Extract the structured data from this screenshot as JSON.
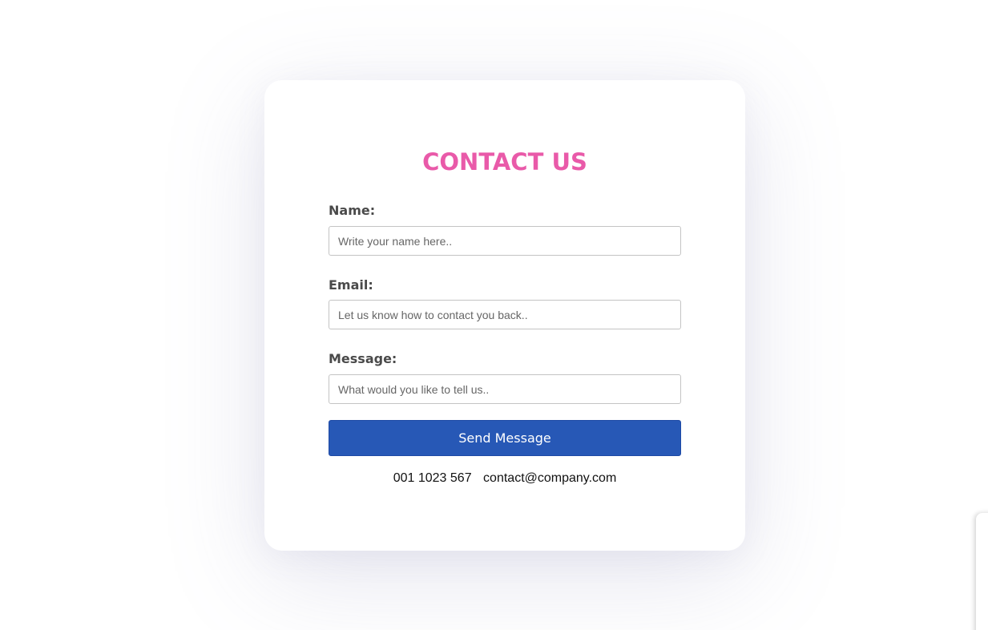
{
  "contact_form": {
    "title": "CONTACT US",
    "name_label": "Name:",
    "name_placeholder": "Write your name here..",
    "email_label": "Email:",
    "email_placeholder": "Let us know how to contact you back..",
    "message_label": "Message:",
    "message_placeholder": "What would you like to tell us..",
    "submit_label": "Send Message",
    "phone": "001 1023 567",
    "email_address": "contact@company.com"
  },
  "colors": {
    "title": "#e95aa9",
    "button": "#2758b6",
    "label": "#4a4a4a"
  }
}
